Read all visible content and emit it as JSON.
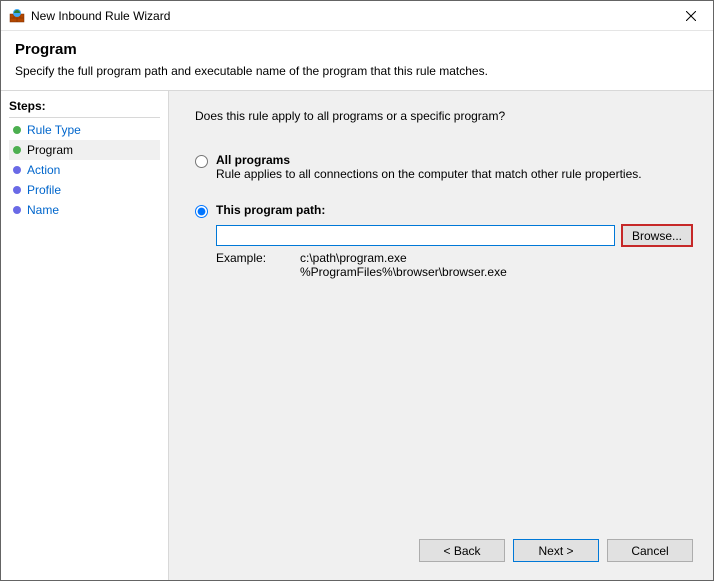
{
  "window": {
    "title": "New Inbound Rule Wizard"
  },
  "header": {
    "title": "Program",
    "subtitle": "Specify the full program path and executable name of the program that this rule matches."
  },
  "sidebar": {
    "title": "Steps:",
    "items": [
      {
        "label": "Rule Type",
        "status": "done",
        "link": true
      },
      {
        "label": "Program",
        "status": "done",
        "link": false,
        "active": true
      },
      {
        "label": "Action",
        "status": "pending",
        "link": true
      },
      {
        "label": "Profile",
        "status": "pending",
        "link": true
      },
      {
        "label": "Name",
        "status": "pending",
        "link": true
      }
    ]
  },
  "main": {
    "question": "Does this rule apply to all programs or a specific program?",
    "options": {
      "all": {
        "title": "All programs",
        "desc": "Rule applies to all connections on the computer that match other rule properties."
      },
      "path": {
        "title": "This program path:",
        "value": "",
        "browse": "Browse...",
        "example_label": "Example:",
        "example_text": "c:\\path\\program.exe\n%ProgramFiles%\\browser\\browser.exe"
      }
    }
  },
  "buttons": {
    "back": "< Back",
    "next": "Next >",
    "cancel": "Cancel"
  }
}
